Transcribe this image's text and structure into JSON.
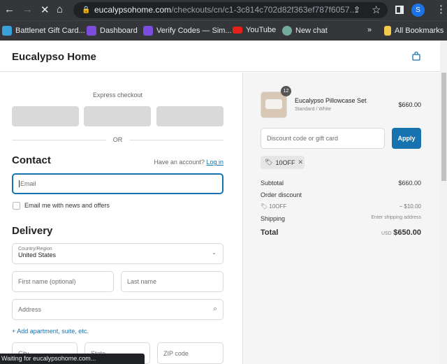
{
  "browser": {
    "url_domain": "eucalypsohome.com",
    "url_path": "/checkouts/cn/c1-3c814c702d82f363ef787f6057...",
    "profile_initial": "S",
    "bookmarks": [
      "Battlenet Gift Card...",
      "Dashboard",
      "Verify Codes — Sim...",
      "YouTube",
      "New chat"
    ],
    "more": "»",
    "all_bookmarks": "All Bookmarks",
    "status": "Waiting for eucalypsohome.com..."
  },
  "header": {
    "store_name": "Eucalypso Home"
  },
  "checkout": {
    "express_label": "Express checkout",
    "or_label": "OR",
    "contact_title": "Contact",
    "have_account": "Have an account?",
    "login": "Log in",
    "email_placeholder": "Email",
    "newsletter_label": "Email me with news and offers",
    "delivery_title": "Delivery",
    "country_label": "Country/Region",
    "country_value": "United States",
    "first_name": "First name (optional)",
    "last_name": "Last name",
    "address": "Address",
    "add_apartment": "+ Add apartment, suite, etc.",
    "city": "City",
    "state": "State",
    "zip": "ZIP code"
  },
  "summary": {
    "product_name": "Eucalypso Pillowcase Set",
    "variant": "Standard / White",
    "quantity": "12",
    "price": "$660.00",
    "discount_placeholder": "Discount code or gift card",
    "apply": "Apply",
    "code": "10OFF",
    "subtotal_label": "Subtotal",
    "subtotal": "$660.00",
    "order_discount_label": "Order discount",
    "discount_code": "10OFF",
    "discount_amount": "− $10.00",
    "shipping_label": "Shipping",
    "shipping_value": "Enter shipping address",
    "total_label": "Total",
    "currency": "USD",
    "total": "$650.00"
  },
  "colors": {
    "accent": "#1773b0",
    "chrome": "#35363a"
  }
}
